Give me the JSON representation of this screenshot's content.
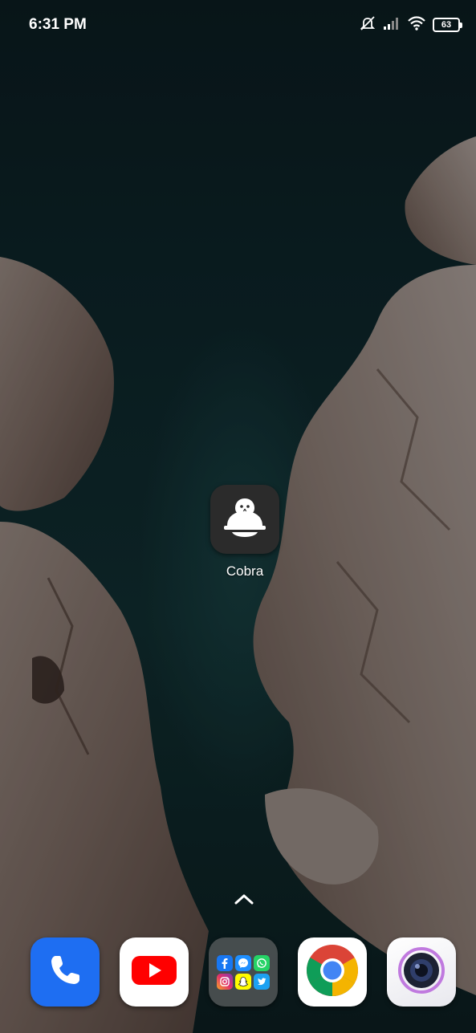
{
  "status_bar": {
    "time": "6:31 PM",
    "battery_level": "63",
    "icons": [
      "alarm-off-icon",
      "signal-icon",
      "wifi-icon",
      "battery-icon"
    ]
  },
  "home_screen": {
    "apps": [
      {
        "label": "Cobra",
        "icon": "cobra-helmet-icon"
      }
    ],
    "drawer_handle_icon": "chevron-up-icon"
  },
  "dock": {
    "apps": [
      {
        "name": "phone-app",
        "icon": "phone-icon",
        "color": "#1e6ef2"
      },
      {
        "name": "youtube-app",
        "icon": "youtube-icon",
        "color": "#ff0000"
      },
      {
        "name": "social-folder",
        "icon": "folder-icon",
        "contents": [
          "facebook",
          "messenger",
          "whatsapp",
          "instagram",
          "snapchat",
          "twitter"
        ]
      },
      {
        "name": "chrome-app",
        "icon": "chrome-icon"
      },
      {
        "name": "camera-app",
        "icon": "camera-icon"
      }
    ]
  }
}
